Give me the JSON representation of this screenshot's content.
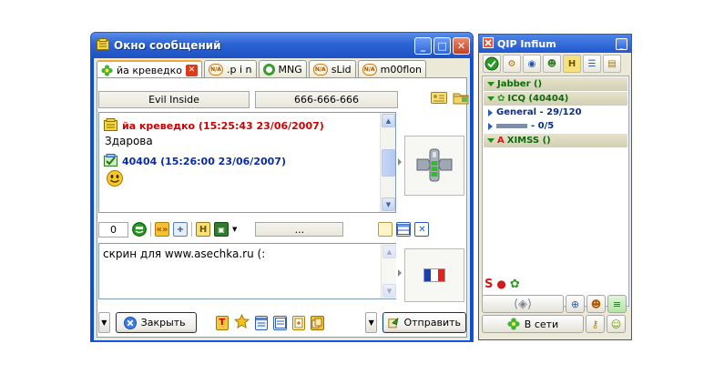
{
  "message_window": {
    "title": "Окно сообщений",
    "tabs": [
      {
        "label": "йа креведко",
        "active": true,
        "icon": "flower-online-icon"
      },
      {
        "label": ".p i n",
        "active": false,
        "icon": "na-status-icon"
      },
      {
        "label": "MNG",
        "active": false,
        "icon": "ring-status-icon"
      },
      {
        "label": "sLid",
        "active": false,
        "icon": "na-status-icon"
      },
      {
        "label": "m00flon",
        "active": false,
        "icon": "na-status-icon"
      }
    ],
    "info": {
      "nick": "Evil Inside",
      "phone": "666-666-666"
    },
    "messages": [
      {
        "header": "йа креведко (15:25:43 23/06/2007)",
        "text": "Здарова",
        "color": "#d00000"
      },
      {
        "header": "40404 (15:26:00 23/06/2007)",
        "text": "",
        "color": "#0a2ca0",
        "smiley": true
      }
    ],
    "counter": "0",
    "toolbar_dots": "...",
    "input_text": "скрин для www.asechka.ru (:",
    "close_label": "Закрыть",
    "send_label": "Отправить"
  },
  "qip": {
    "title": "QIP Infium",
    "groups": [
      {
        "label": "Jabber ()",
        "kind": "group"
      },
      {
        "label": "ICQ (40404)",
        "kind": "group"
      },
      {
        "label": "General - 29/120",
        "kind": "sub"
      },
      {
        "label": "- 0/5",
        "kind": "sub"
      },
      {
        "label": "XIMSS ()",
        "kind": "group"
      }
    ],
    "status_label": "В сети"
  },
  "colors": {
    "accent": "#0a4fd3",
    "panel": "#ece9d8",
    "group_text": "#0d6a0b"
  }
}
